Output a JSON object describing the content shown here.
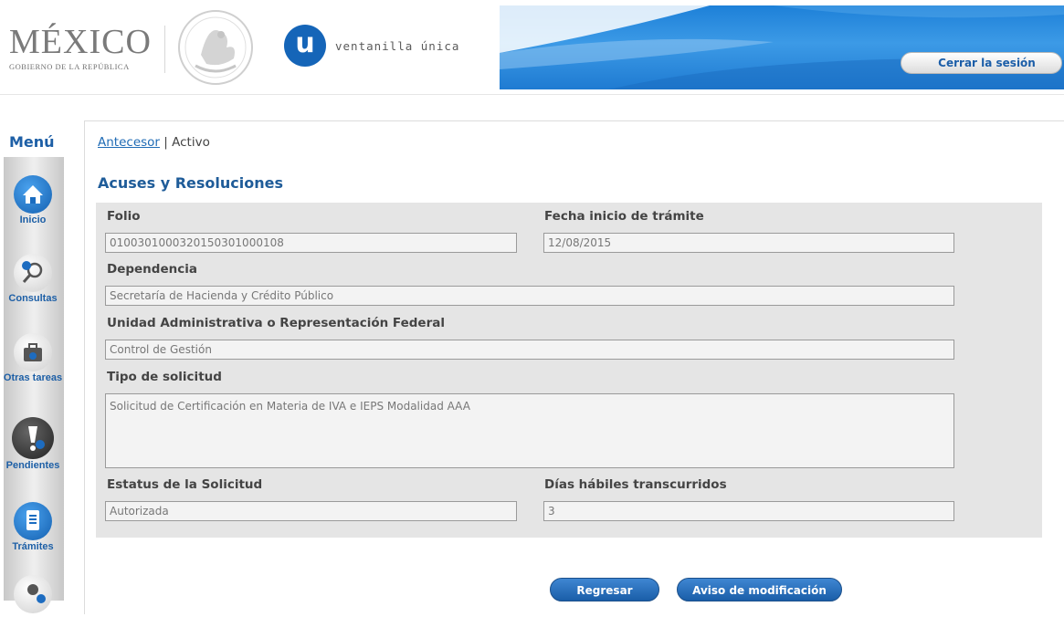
{
  "header": {
    "logo_main": "MÉXICO",
    "logo_sub": "GOBIERNO DE LA REPÚBLICA",
    "vu_letter": "u",
    "vu_text": "ventanilla única",
    "logout_label": "Cerrar la sesión"
  },
  "sidebar": {
    "title": "Menú",
    "items": [
      {
        "label": "Inicio",
        "icon": "home-icon"
      },
      {
        "label": "Consultas",
        "icon": "magnifier-icon"
      },
      {
        "label": "Otras tareas",
        "icon": "briefcase-icon"
      },
      {
        "label": "Pendientes",
        "icon": "alert-icon"
      },
      {
        "label": "Trámites",
        "icon": "document-icon"
      }
    ]
  },
  "breadcrumb": {
    "link": "Antecesor",
    "separator": " | ",
    "current": "Activo"
  },
  "section_title": "Acuses y Resoluciones",
  "form": {
    "folio_label": "Folio",
    "folio_value": "0100301000320150301000108",
    "fecha_label": "Fecha inicio de trámite",
    "fecha_value": "12/08/2015",
    "dependencia_label": "Dependencia",
    "dependencia_value": "Secretaría de Hacienda y Crédito Público",
    "unidad_label": "Unidad Administrativa o Representación Federal",
    "unidad_value": "Control de Gestión",
    "tipo_label": "Tipo de solicitud",
    "tipo_value": "Solicitud de Certificación en Materia de IVA e IEPS Modalidad AAA",
    "estatus_label": "Estatus de la Solicitud",
    "estatus_value": "Autorizada",
    "dias_label": "Días hábiles transcurridos",
    "dias_value": "3"
  },
  "buttons": {
    "regresar": "Regresar",
    "aviso": "Aviso de modificación"
  },
  "colors": {
    "primary_blue": "#1d5fa6",
    "banner_blue": "#2a8ae0",
    "form_bg": "#e5e5e5"
  }
}
